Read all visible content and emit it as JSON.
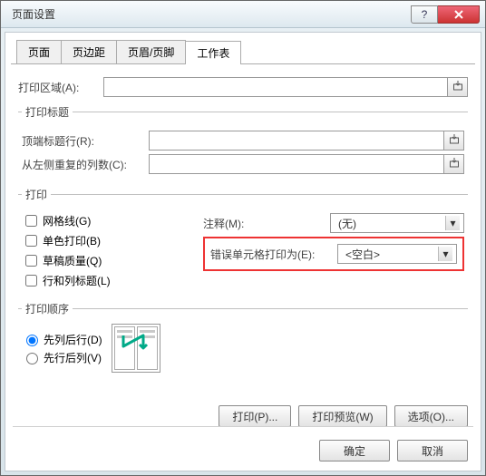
{
  "window": {
    "title": "页面设置"
  },
  "tabs": {
    "items": [
      {
        "label": "页面"
      },
      {
        "label": "页边距"
      },
      {
        "label": "页眉/页脚"
      },
      {
        "label": "工作表"
      }
    ],
    "activeIndex": 3
  },
  "print_area": {
    "label": "打印区域(A):",
    "value": ""
  },
  "print_titles": {
    "legend": "打印标题",
    "rows": {
      "label": "顶端标题行(R):",
      "value": ""
    },
    "columns": {
      "label": "从左侧重复的列数(C):",
      "value": ""
    }
  },
  "print_section": {
    "legend": "打印",
    "checks": {
      "gridlines": {
        "label": "网格线(G)",
        "checked": false
      },
      "bw": {
        "label": "单色打印(B)",
        "checked": false
      },
      "draft": {
        "label": "草稿质量(Q)",
        "checked": false
      },
      "rowcolhdrs": {
        "label": "行和列标题(L)",
        "checked": false
      }
    },
    "comments": {
      "label": "注释(M):",
      "value": "(无)"
    },
    "errors": {
      "label": "错误单元格打印为(E):",
      "value": "<空白>"
    }
  },
  "page_order": {
    "legend": "打印顺序",
    "radios": {
      "downover": {
        "label": "先列后行(D)",
        "checked": true
      },
      "overdown": {
        "label": "先行后列(V)",
        "checked": false
      }
    }
  },
  "buttons": {
    "print": "打印(P)...",
    "preview": "打印预览(W)",
    "options": "选项(O)..."
  },
  "footer": {
    "ok": "确定",
    "cancel": "取消"
  }
}
